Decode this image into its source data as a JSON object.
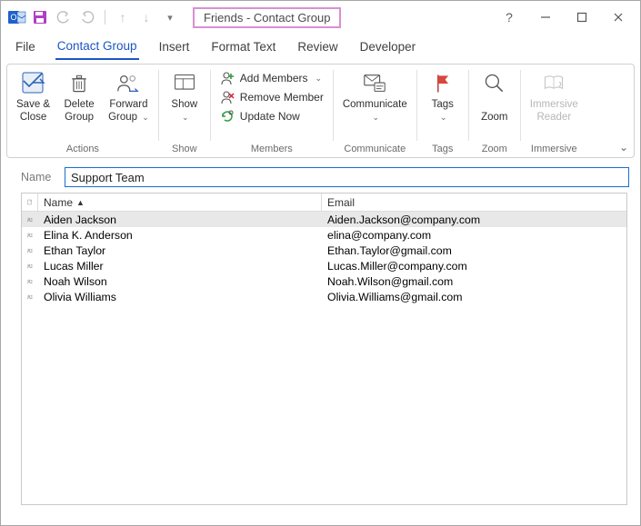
{
  "titlebar": {
    "title": "Friends  -  Contact Group"
  },
  "tabs": {
    "file": "File",
    "contact_group": "Contact Group",
    "insert": "Insert",
    "format_text": "Format Text",
    "review": "Review",
    "developer": "Developer"
  },
  "ribbon": {
    "actions": {
      "label": "Actions",
      "save_close": "Save &\nClose",
      "delete_group": "Delete\nGroup",
      "forward_group": "Forward\nGroup"
    },
    "show": {
      "label": "Show",
      "show": "Show"
    },
    "members": {
      "label": "Members",
      "add_members": "Add Members",
      "remove_member": "Remove Member",
      "update_now": "Update Now"
    },
    "communicate": {
      "label": "Communicate",
      "btn": "Communicate"
    },
    "tags": {
      "label": "Tags",
      "btn": "Tags"
    },
    "zoom": {
      "label": "Zoom",
      "btn": "Zoom"
    },
    "immersive": {
      "label": "Immersive",
      "btn": "Immersive\nReader"
    }
  },
  "name_field": {
    "label": "Name",
    "value": "Support Team"
  },
  "columns": {
    "name": "Name",
    "email": "Email"
  },
  "members_list": [
    {
      "name": "Aiden Jackson",
      "email": "Aiden.Jackson@company.com",
      "selected": true
    },
    {
      "name": "Elina K. Anderson",
      "email": "elina@company.com",
      "selected": false
    },
    {
      "name": "Ethan Taylor",
      "email": "Ethan.Taylor@gmail.com",
      "selected": false
    },
    {
      "name": "Lucas Miller",
      "email": "Lucas.Miller@company.com",
      "selected": false
    },
    {
      "name": "Noah Wilson",
      "email": "Noah.Wilson@gmail.com",
      "selected": false
    },
    {
      "name": "Olivia Williams",
      "email": "Olivia.Williams@gmail.com",
      "selected": false
    }
  ]
}
